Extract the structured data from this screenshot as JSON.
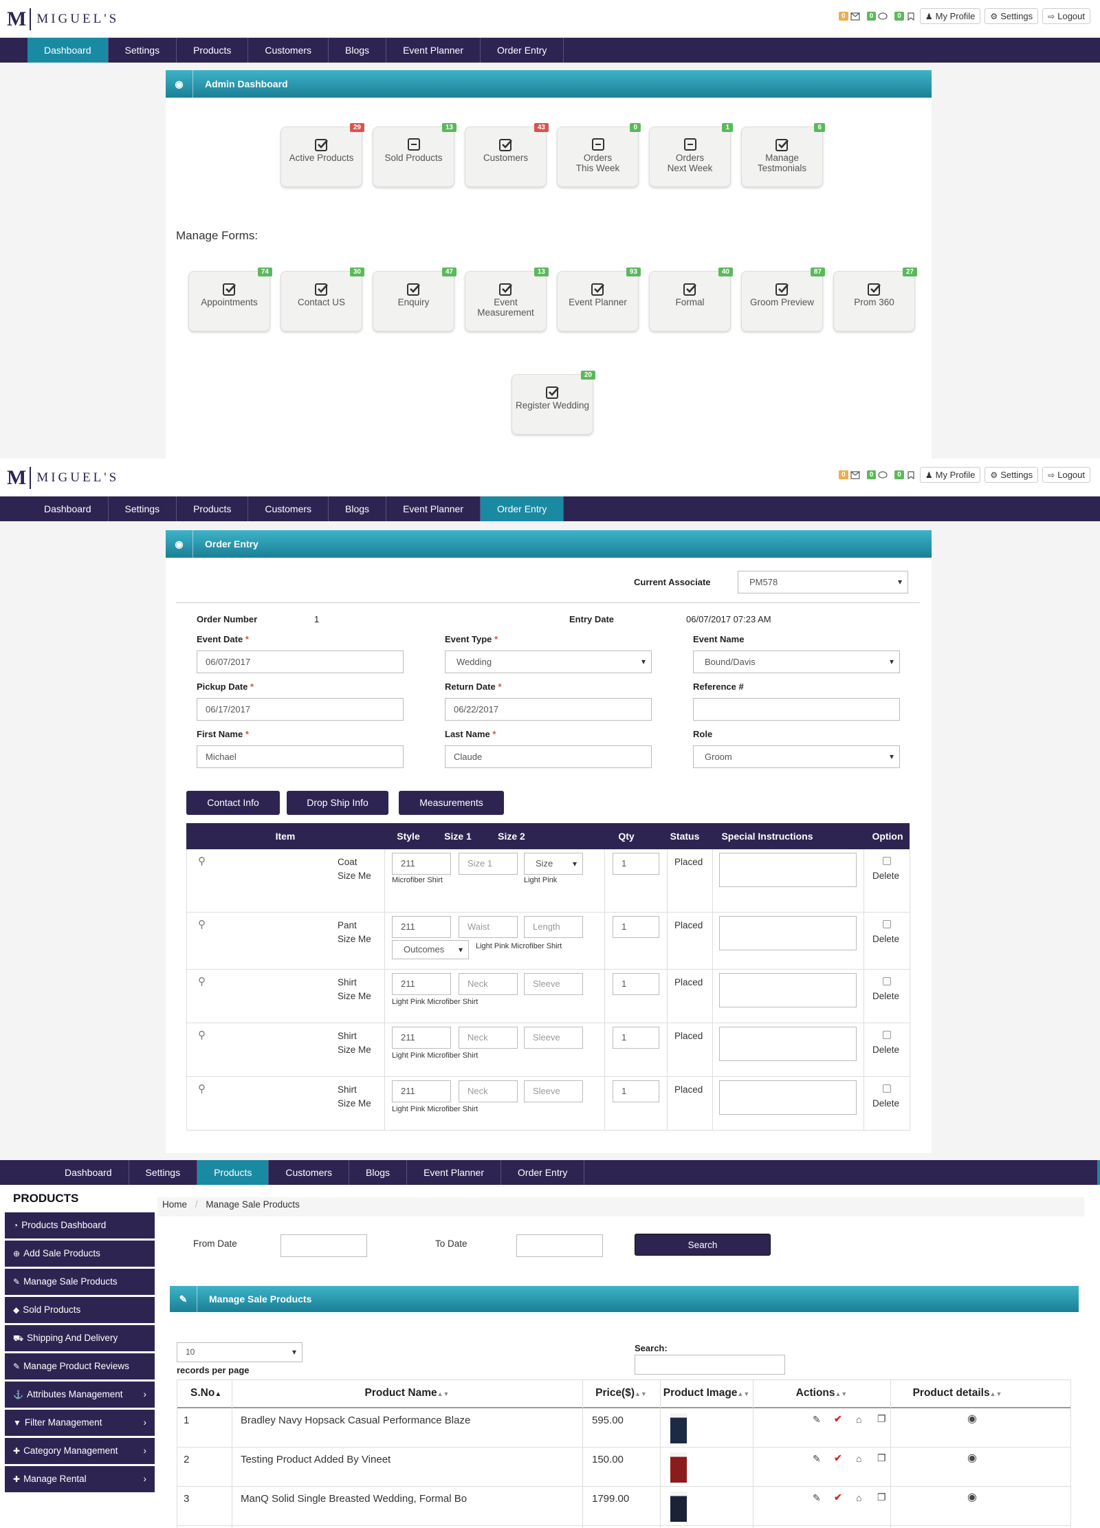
{
  "brand": {
    "mark": "M",
    "name": "MIGUEL'S"
  },
  "topbar": {
    "counters": [
      {
        "count": "0",
        "icon": "envelope-icon",
        "color": "#f0ad4e"
      },
      {
        "count": "0",
        "icon": "comment-icon",
        "color": "#5cb85c"
      },
      {
        "count": "0",
        "icon": "bookmark-icon",
        "color": "#5cb85c"
      }
    ],
    "my_profile": "My Profile",
    "settings": "Settings",
    "logout": "Logout"
  },
  "nav": [
    "Dashboard",
    "Settings",
    "Products",
    "Customers",
    "Blogs",
    "Event Planner",
    "Order Entry"
  ],
  "dashboard": {
    "title": "Admin Dashboard",
    "cards": [
      {
        "line1": "Active Products",
        "line2": "",
        "badge": "29",
        "badge_color": "red",
        "icon": "check-square-icon"
      },
      {
        "line1": "Sold Products",
        "line2": "",
        "badge": "13",
        "badge_color": "green",
        "icon": "minus-square-icon"
      },
      {
        "line1": "Customers",
        "line2": "",
        "badge": "43",
        "badge_color": "red",
        "icon": "check-square-icon"
      },
      {
        "line1": "Orders",
        "line2": "This Week",
        "badge": "0",
        "badge_color": "green",
        "icon": "minus-square-icon"
      },
      {
        "line1": "Orders",
        "line2": "Next Week",
        "badge": "1",
        "badge_color": "green",
        "icon": "minus-square-icon"
      },
      {
        "line1": "Manage",
        "line2": "Testmonials",
        "badge": "6",
        "badge_color": "green",
        "icon": "check-square-icon"
      }
    ],
    "forms_label": "Manage Forms:",
    "forms": [
      {
        "line1": "Appointments",
        "line2": "",
        "badge": "74"
      },
      {
        "line1": "Contact US",
        "line2": "",
        "badge": "30"
      },
      {
        "line1": "Enquiry",
        "line2": "",
        "badge": "47"
      },
      {
        "line1": "Event",
        "line2": "Measurement",
        "badge": "13"
      },
      {
        "line1": "Event Planner",
        "line2": "",
        "badge": "93"
      },
      {
        "line1": "Formal",
        "line2": "",
        "badge": "40"
      },
      {
        "line1": "Groom Preview",
        "line2": "",
        "badge": "87"
      },
      {
        "line1": "Prom 360",
        "line2": "",
        "badge": "27"
      },
      {
        "line1": "Register Wedding",
        "line2": "",
        "badge": "20"
      }
    ]
  },
  "order": {
    "title": "Order Entry",
    "associate_label": "Current Associate",
    "associate_value": "PM578",
    "order_number_label": "Order Number",
    "order_number": "1",
    "entry_date_label": "Entry Date",
    "entry_date": "06/07/2017 07:23 AM",
    "event_date_label": "Event Date",
    "event_date": "06/07/2017",
    "event_type_label": "Event Type",
    "event_type": "Wedding",
    "event_name_label": "Event Name",
    "event_name": "Bound/Davis",
    "pickup_label": "Pickup Date",
    "pickup": "06/17/2017",
    "return_label": "Return Date",
    "return": "06/22/2017",
    "reference_label": "Reference #",
    "reference": "",
    "first_label": "First Name",
    "first": "Michael",
    "last_label": "Last Name",
    "last": "Claude",
    "role_label": "Role",
    "role": "Groom",
    "required_mark": "*",
    "buttons": [
      "Contact Info",
      "Drop Ship Info",
      "Measurements"
    ],
    "columns": {
      "item": "Item",
      "style": "Style",
      "size1": "Size 1",
      "size2": "Size 2",
      "qty": "Qty",
      "status": "Status",
      "special": "Special Instructions",
      "option": "Option"
    },
    "rows": [
      {
        "name": "Coat",
        "sub": "Size Me",
        "style": "211",
        "f1": "Size 1",
        "f2": "Size",
        "f2_select": true,
        "note": "Microfiber Shirt",
        "note2": "Light Pink",
        "outcome": "",
        "qty": "1",
        "status": "Placed",
        "opt": "Delete"
      },
      {
        "name": "Pant",
        "sub": "Size Me",
        "style": "211",
        "f1": "Waist",
        "f2": "Length",
        "f2_select": false,
        "note": "",
        "note2": "Light Pink Microfiber Shirt",
        "outcome": "Outcomes",
        "qty": "1",
        "status": "Placed",
        "opt": "Delete"
      },
      {
        "name": "Shirt",
        "sub": "Size Me",
        "style": "211",
        "f1": "Neck",
        "f2": "Sleeve",
        "f2_select": false,
        "note": "Light Pink Microfiber Shirt",
        "note2": "",
        "outcome": "",
        "qty": "1",
        "status": "Placed",
        "opt": "Delete"
      },
      {
        "name": "Shirt",
        "sub": "Size Me",
        "style": "211",
        "f1": "Neck",
        "f2": "Sleeve",
        "f2_select": false,
        "note": "Light Pink Microfiber Shirt",
        "note2": "",
        "outcome": "",
        "qty": "1",
        "status": "Placed",
        "opt": "Delete"
      },
      {
        "name": "Shirt",
        "sub": "Size Me",
        "style": "211",
        "f1": "Neck",
        "f2": "Sleeve",
        "f2_select": false,
        "note": "Light Pink Microfiber Shirt",
        "note2": "",
        "outcome": "",
        "qty": "1",
        "status": "Placed",
        "opt": "Delete"
      }
    ]
  },
  "products": {
    "sidebar_title": "PRODUCTS",
    "sidebar": [
      {
        "label": "Products Dashboard",
        "icon": "dashboard-icon",
        "arrow": ""
      },
      {
        "label": "Add Sale Products",
        "icon": "plus-circle-icon",
        "arrow": ""
      },
      {
        "label": "Manage Sale Products",
        "icon": "edit-icon",
        "arrow": ""
      },
      {
        "label": "Sold Products",
        "icon": "tag-icon",
        "arrow": ""
      },
      {
        "label": "Shipping And Delivery",
        "icon": "truck-icon",
        "arrow": ""
      },
      {
        "label": "Manage Product Reviews",
        "icon": "edit-icon",
        "arrow": ""
      },
      {
        "label": "Attributes Management",
        "icon": "anchor-icon",
        "arrow": "›"
      },
      {
        "label": "Filter Management",
        "icon": "filter-icon",
        "arrow": "›"
      },
      {
        "label": "Category Management",
        "icon": "plus-icon",
        "arrow": "›"
      },
      {
        "label": "Manage Rental",
        "icon": "plus-icon",
        "arrow": "›"
      }
    ],
    "breadcrumb": [
      "Home",
      "Manage Sale Products"
    ],
    "breadcrumb_sep": "/",
    "from_label": "From Date",
    "to_label": "To Date",
    "search_button": "Search",
    "panel_title": "Manage Sale Products",
    "per_page": "10",
    "per_page_label": "records per page",
    "search_label": "Search:",
    "columns": [
      "S.No",
      "Product Name",
      "Price($)",
      "Product Image",
      "Actions",
      "Product details"
    ],
    "rows": [
      {
        "sno": "1",
        "name": "Bradley Navy Hopsack Casual Performance Blaze",
        "price": "595.00",
        "img_color": "#1d2a44"
      },
      {
        "sno": "2",
        "name": "Testing Product Added By Vineet",
        "price": "150.00",
        "img_color": "#8a1c1c"
      },
      {
        "sno": "3",
        "name": "ManQ Solid Single Breasted Wedding, Formal Bo",
        "price": "1799.00",
        "img_color": "#1b2236"
      }
    ]
  }
}
